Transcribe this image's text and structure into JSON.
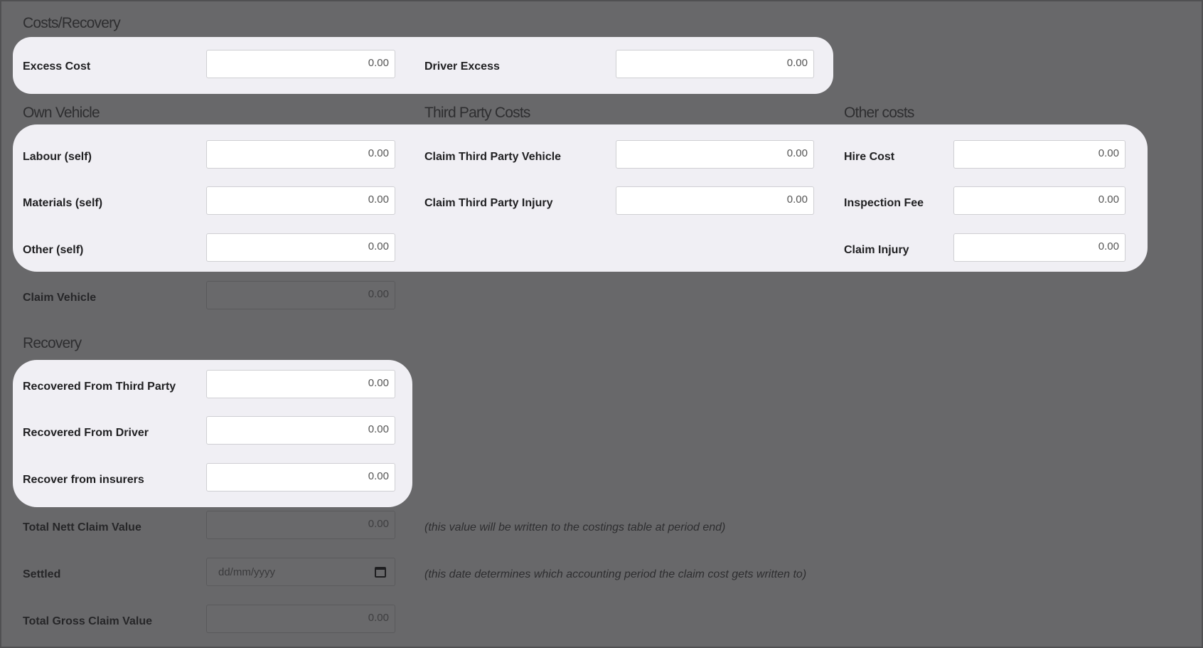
{
  "sections": {
    "costs_recovery": "Costs/Recovery",
    "own_vehicle": "Own Vehicle",
    "third_party_costs": "Third Party Costs",
    "other_costs": "Other costs",
    "recovery": "Recovery"
  },
  "fields": {
    "excess_cost": {
      "label": "Excess Cost",
      "value": "0.00"
    },
    "driver_excess": {
      "label": "Driver Excess",
      "value": "0.00"
    },
    "labour_self": {
      "label": "Labour (self)",
      "value": "0.00"
    },
    "materials_self": {
      "label": "Materials (self)",
      "value": "0.00"
    },
    "other_self": {
      "label": "Other (self)",
      "value": "0.00"
    },
    "claim_vehicle": {
      "label": "Claim Vehicle",
      "value": "0.00"
    },
    "claim_third_party_vehicle": {
      "label": "Claim Third Party Vehicle",
      "value": "0.00"
    },
    "claim_third_party_injury": {
      "label": "Claim Third Party Injury",
      "value": "0.00"
    },
    "hire_cost": {
      "label": "Hire Cost",
      "value": "0.00"
    },
    "inspection_fee": {
      "label": "Inspection Fee",
      "value": "0.00"
    },
    "claim_injury": {
      "label": "Claim Injury",
      "value": "0.00"
    },
    "recovered_from_third_party": {
      "label": "Recovered From Third Party",
      "value": "0.00"
    },
    "recovered_from_driver": {
      "label": "Recovered From Driver",
      "value": "0.00"
    },
    "recover_from_insurers": {
      "label": "Recover from insurers",
      "value": "0.00"
    },
    "total_nett_claim_value": {
      "label": "Total Nett Claim Value",
      "value": "0.00",
      "note": "(this value will be written to the costings table at period end)"
    },
    "settled": {
      "label": "Settled",
      "placeholder": "dd/mm/yyyy",
      "note": "(this date determines which accounting period the claim cost gets written to)"
    },
    "total_gross_claim_value": {
      "label": "Total Gross Claim Value",
      "value": "0.00"
    }
  },
  "colors": {
    "overlay": "#68686a",
    "highlight": "#f0eff4"
  }
}
